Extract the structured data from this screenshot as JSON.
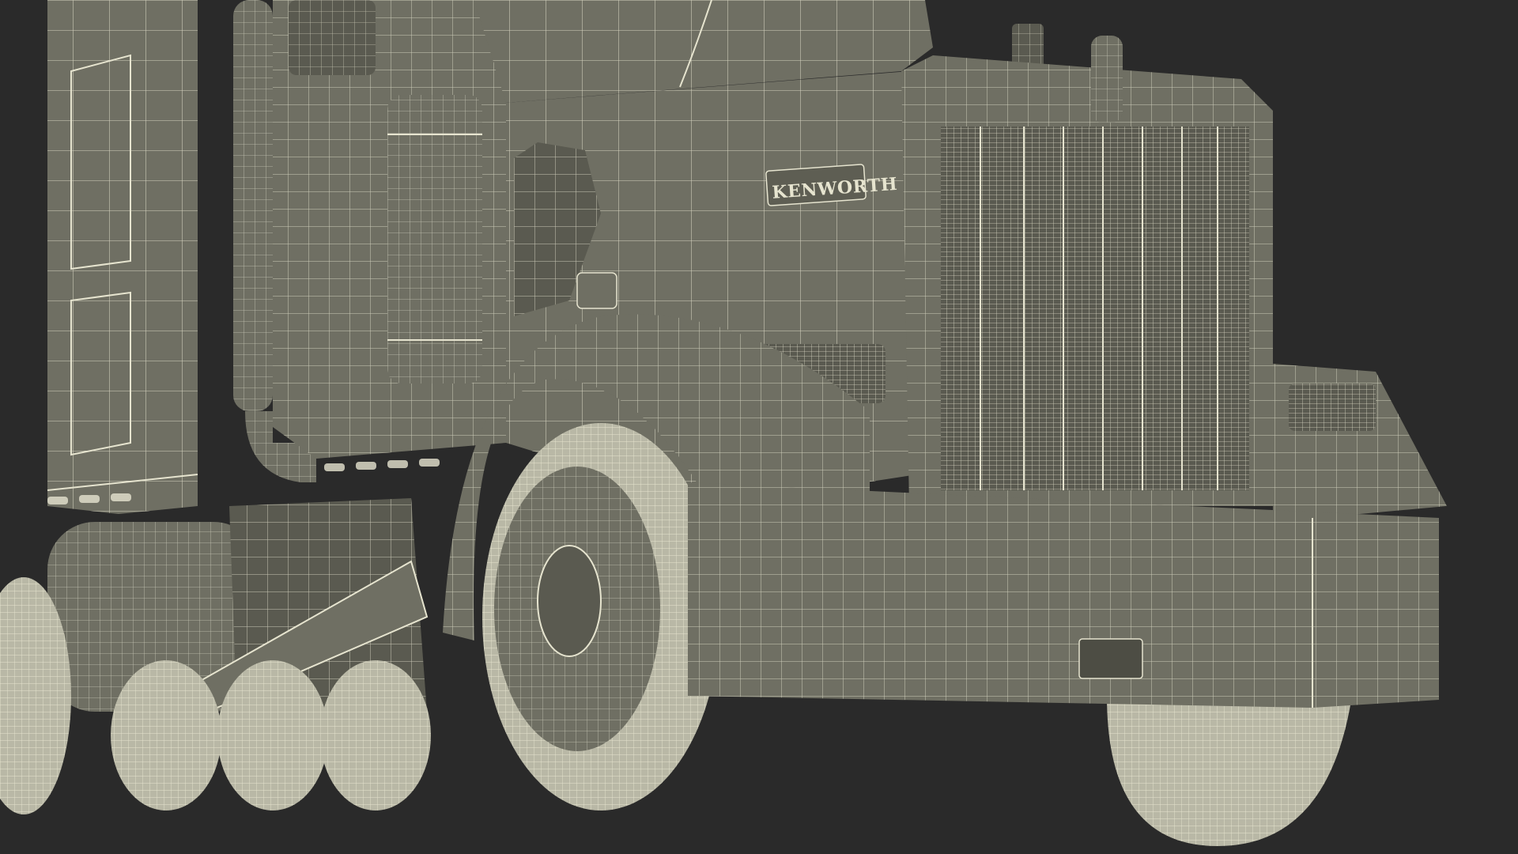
{
  "scene": {
    "background_color": "#2a2a2a",
    "body_color": "#6f6f63",
    "body_shadow_color": "#5a5a50",
    "wire_color": "#e6e4cf",
    "tire_color": "#b9b8a6"
  },
  "badge": {
    "text": "KENWORTH"
  }
}
